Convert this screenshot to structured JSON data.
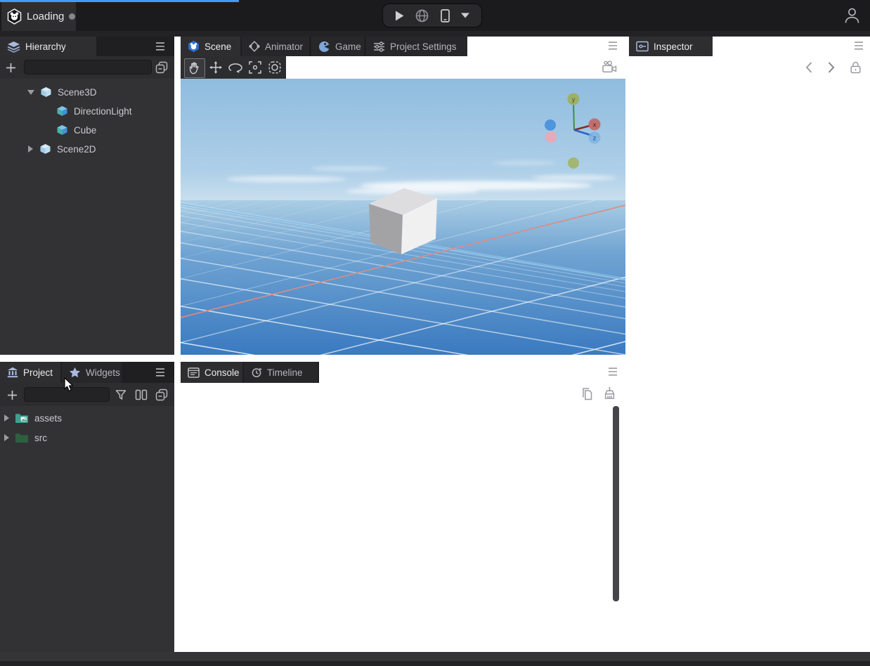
{
  "topbar": {
    "project_tab": {
      "label": "Loading",
      "status_dot": "idle"
    },
    "run_controls": {
      "play": "play",
      "web": "preview-web",
      "device": "preview-device",
      "more": "more-options"
    },
    "account": "user-avatar"
  },
  "hierarchy": {
    "title": "Hierarchy",
    "search": {
      "value": "",
      "placeholder": ""
    },
    "tree": [
      {
        "label": "Scene3D",
        "type": "scene",
        "expanded": true,
        "indent": 0
      },
      {
        "label": "DirectionLight",
        "type": "entity",
        "indent": 1
      },
      {
        "label": "Cube",
        "type": "entity",
        "indent": 1
      },
      {
        "label": "Scene2D",
        "type": "scene",
        "expanded": false,
        "indent": 0
      }
    ]
  },
  "scene_panel": {
    "tabs": [
      {
        "label": "Scene",
        "active": true
      },
      {
        "label": "Animator",
        "active": false
      },
      {
        "label": "Game",
        "active": false
      },
      {
        "label": "Project Settings",
        "active": false
      }
    ],
    "tools": [
      "hand",
      "move",
      "rotate",
      "frame",
      "region"
    ],
    "camera_tool": "scene-camera",
    "gizmo": {
      "x_label": "x",
      "y_label": "y",
      "z_label": "z"
    }
  },
  "inspector": {
    "title": "Inspector",
    "nav": [
      "back",
      "forward",
      "lock"
    ]
  },
  "project_panel": {
    "tabs": [
      {
        "label": "Project",
        "active": true
      },
      {
        "label": "Widgets",
        "active": false
      }
    ],
    "search": {
      "value": "",
      "placeholder": ""
    },
    "tree": [
      {
        "label": "assets",
        "type": "folder-assets"
      },
      {
        "label": "src",
        "type": "folder-src"
      }
    ]
  },
  "console_panel": {
    "tabs": [
      {
        "label": "Console",
        "active": true
      },
      {
        "label": "Timeline",
        "active": false
      }
    ],
    "actions": [
      "copy",
      "clear"
    ],
    "entries": []
  },
  "colors": {
    "accent_blue": "#3f9bf5",
    "topbar": "#1b1b1d",
    "panel_toolbar": "#2d2d2f",
    "panel_body": "#323234",
    "tab_active": "#2e2e30",
    "icon_periwinkle": "#aab9de",
    "sky_top": "#8fbcde",
    "ground_deep": "#3a7ac0",
    "axis_x_red": "#e08a80",
    "axis_z_blue": "#86c2ea"
  }
}
